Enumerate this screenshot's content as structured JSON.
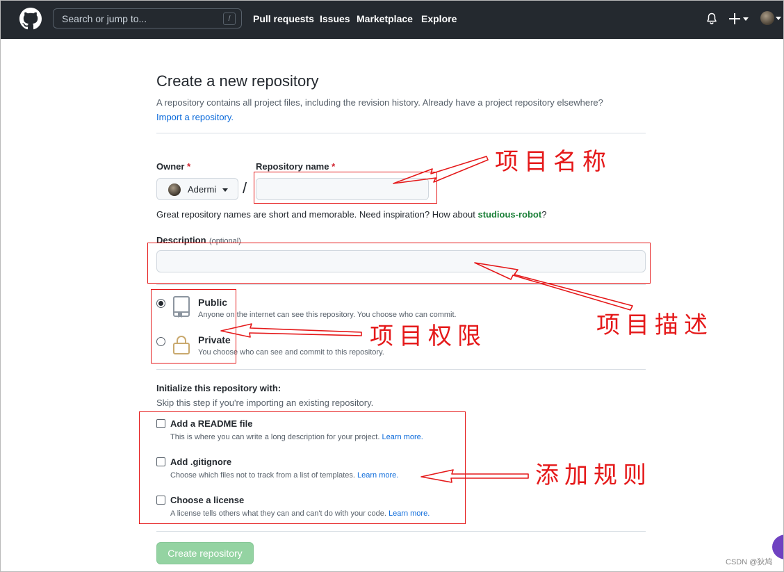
{
  "header": {
    "search_placeholder": "Search or jump to...",
    "search_shortcut": "/",
    "nav": [
      "Pull requests",
      "Issues",
      "Marketplace",
      "Explore"
    ]
  },
  "page": {
    "title": "Create a new repository",
    "subtitle": "A repository contains all project files, including the revision history. Already have a project repository elsewhere?",
    "import_link": "Import a repository."
  },
  "form": {
    "owner_label": "Owner",
    "required_mark": "*",
    "owner_value": "Adermi",
    "separator": "/",
    "repo_name_label": "Repository name",
    "repo_name_value": "",
    "name_hint_prefix": "Great repository names are short and memorable. Need inspiration? How about ",
    "name_suggestion": "studious-robot",
    "name_hint_suffix": "?",
    "description_label": "Description",
    "description_optional": "(optional)",
    "description_value": ""
  },
  "visibility": {
    "options": [
      {
        "title": "Public",
        "desc": "Anyone on the internet can see this repository. You choose who can commit.",
        "selected": true
      },
      {
        "title": "Private",
        "desc": "You choose who can see and commit to this repository.",
        "selected": false
      }
    ]
  },
  "init": {
    "heading": "Initialize this repository with:",
    "hint": "Skip this step if you're importing an existing repository.",
    "learn_more": "Learn more.",
    "items": [
      {
        "title": "Add a README file",
        "desc": "This is where you can write a long description for your project.",
        "checked": false
      },
      {
        "title": "Add .gitignore",
        "desc": "Choose which files not to track from a list of templates.",
        "checked": false
      },
      {
        "title": "Choose a license",
        "desc": "A license tells others what they can and can't do with your code.",
        "checked": false
      }
    ]
  },
  "submit_label": "Create repository",
  "annotations": {
    "name": "项目名称",
    "description": "项目描述",
    "visibility": "项目权限",
    "rules": "添加规则"
  },
  "watermark": "CSDN @狄鸠",
  "colors": {
    "header_bg": "#24292f",
    "annotation_red": "#e5191a",
    "link_blue": "#0969da",
    "suggest_green": "#1a7f37",
    "button_green_disabled": "#94d3a2"
  }
}
